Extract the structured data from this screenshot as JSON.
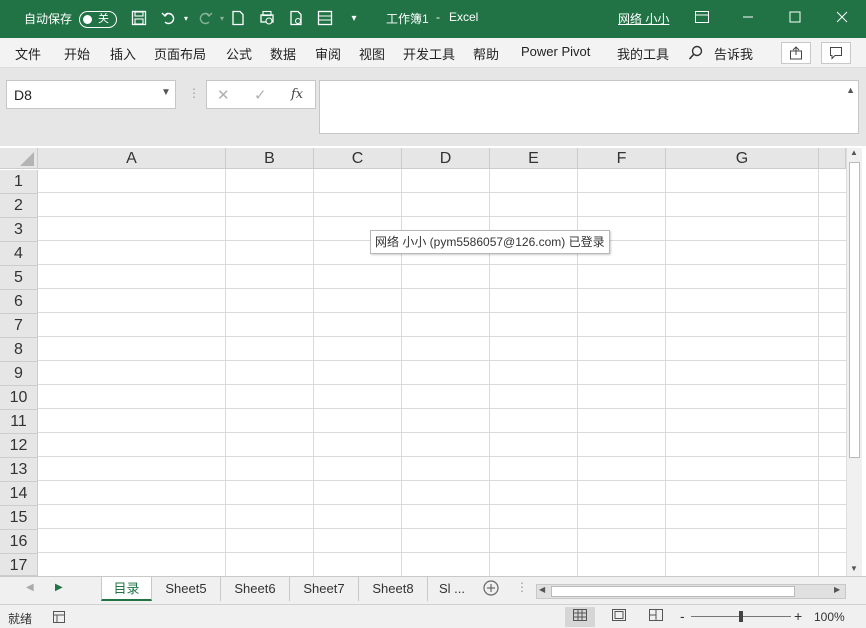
{
  "titlebar": {
    "autosave_label": "自动保存",
    "autosave_state": "关",
    "doc_title": "工作簿1",
    "separator": "-",
    "app_name": "Excel",
    "user_name": "网络 小小"
  },
  "menu": {
    "items": [
      "文件",
      "开始",
      "插入",
      "页面布局",
      "公式",
      "数据",
      "审阅",
      "视图",
      "开发工具",
      "帮助",
      "Power Pivot",
      "我的工具"
    ],
    "tellme": "告诉我"
  },
  "formula": {
    "name_box": "D8",
    "fx_label": "fx"
  },
  "columns": [
    "A",
    "B",
    "C",
    "D",
    "E",
    "F",
    "G"
  ],
  "rows": [
    "1",
    "2",
    "3",
    "4",
    "5",
    "6",
    "7",
    "8",
    "9",
    "10",
    "11",
    "12",
    "13",
    "14",
    "15",
    "16",
    "17"
  ],
  "tooltip": "网络 小小 (pym5586057@126.com) 已登录",
  "tabs": {
    "items": [
      "目录",
      "Sheet5",
      "Sheet6",
      "Sheet7",
      "Sheet8",
      "Sl ..."
    ],
    "active": "目录"
  },
  "status": {
    "ready": "就绪",
    "zoom": "100%"
  },
  "colors": {
    "accent": "#217346"
  }
}
